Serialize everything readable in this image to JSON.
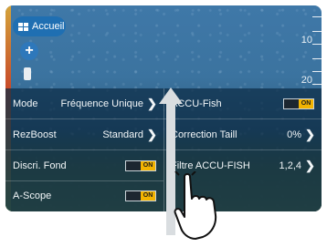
{
  "home": {
    "label": "Accueil"
  },
  "scale": {
    "labels": [
      "10",
      "20"
    ]
  },
  "left_col": [
    {
      "label": "Mode",
      "value": "Fréquence Unique",
      "type": "select"
    },
    {
      "label": "RezBoost",
      "value": "Standard",
      "type": "select"
    },
    {
      "label": "Discri. Fond",
      "toggle": "ON",
      "type": "toggle"
    },
    {
      "label": "A-Scope",
      "toggle": "ON",
      "type": "toggle"
    }
  ],
  "right_col": [
    {
      "label": "ACCU-Fish",
      "toggle": "ON",
      "type": "toggle"
    },
    {
      "label": "Correction Taill",
      "value": "0%",
      "type": "select"
    },
    {
      "label": "Filtre ACCU-FISH",
      "value": "1,2,4",
      "type": "select"
    }
  ],
  "colors": {
    "accent": "#f2b400",
    "pill": "#1f6fb2"
  }
}
